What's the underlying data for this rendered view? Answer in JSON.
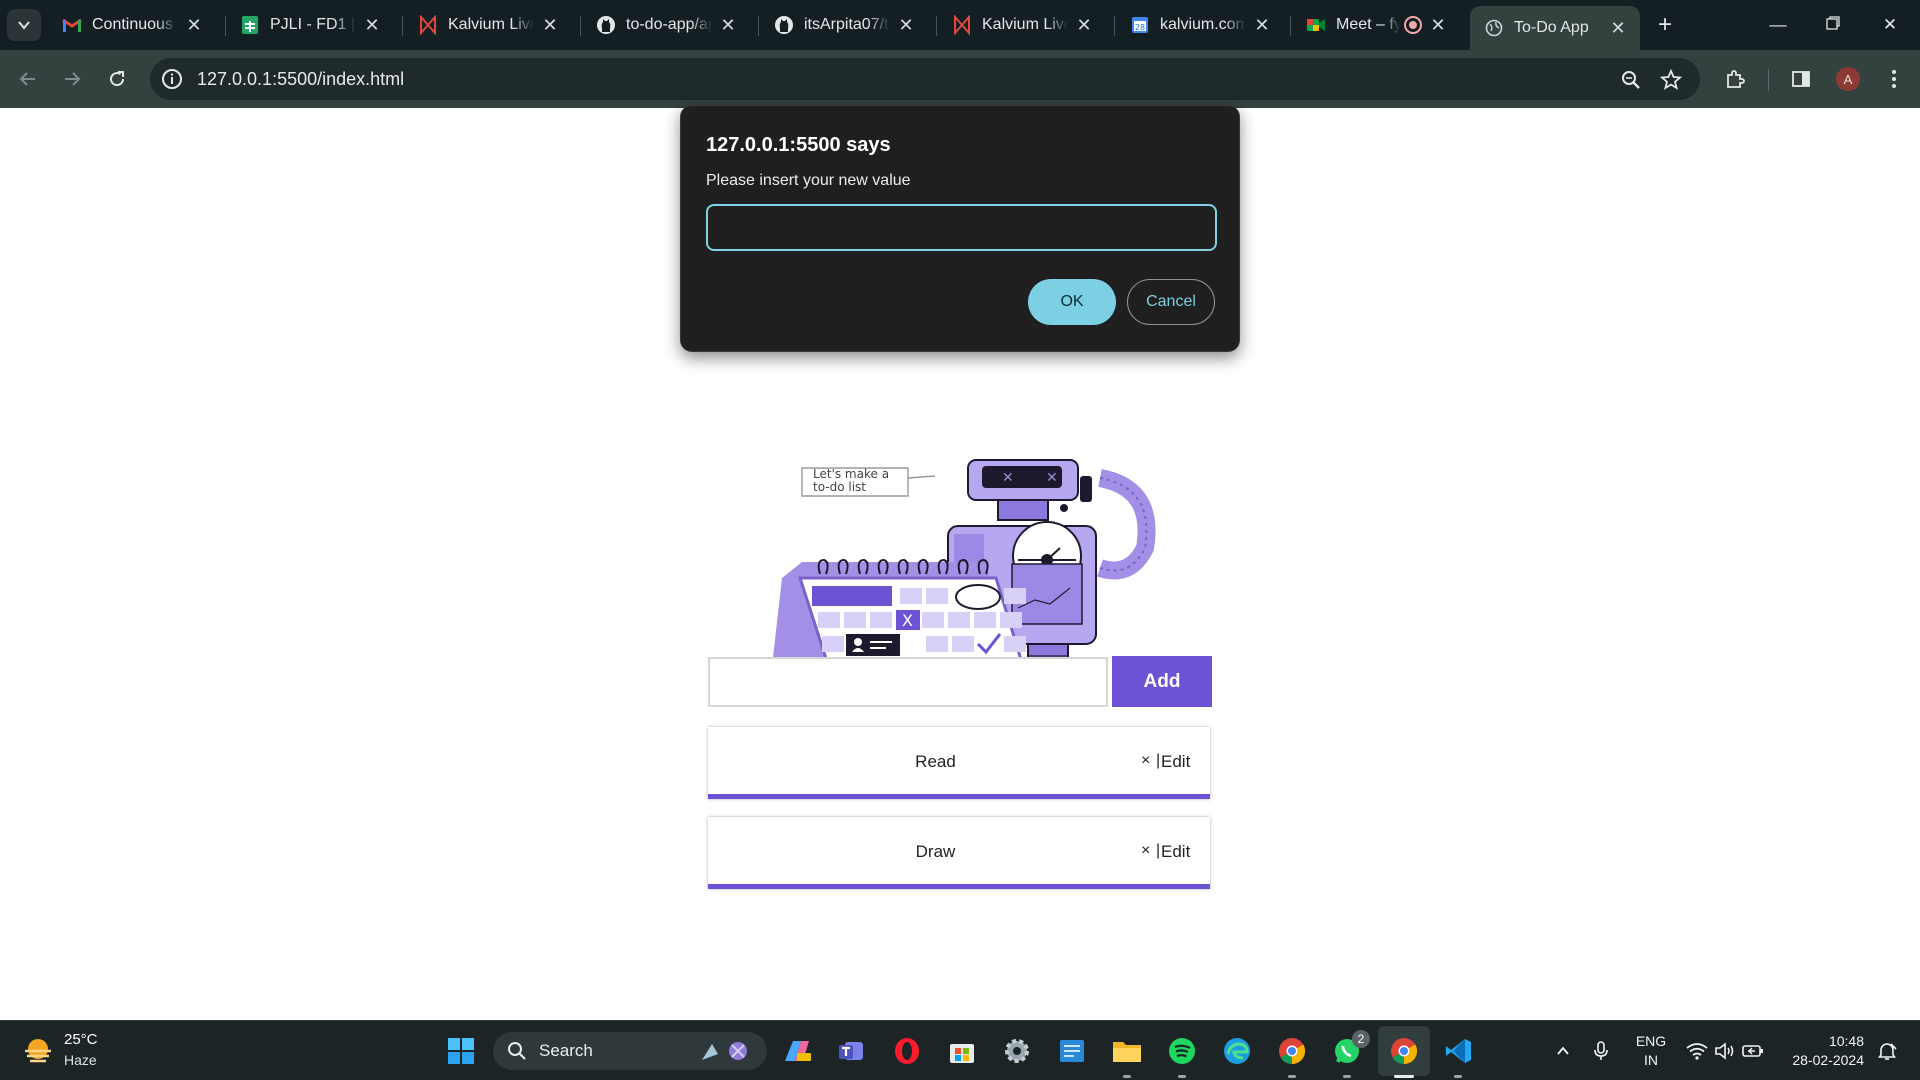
{
  "browser": {
    "tabs": [
      {
        "title": "Continuous A",
        "icon": "gmail-icon",
        "active": false
      },
      {
        "title": "PJLI - FD1 | Sc",
        "icon": "sheets-icon",
        "active": false
      },
      {
        "title": "Kalvium Liveb",
        "icon": "kalvium-icon",
        "active": false
      },
      {
        "title": "to-do-app/ap",
        "icon": "github-icon",
        "active": false
      },
      {
        "title": "itsArpita07/tc",
        "icon": "github-icon",
        "active": false
      },
      {
        "title": "Kalvium Liveb",
        "icon": "kalvium-icon",
        "active": false
      },
      {
        "title": "kalvium.comr",
        "icon": "calendar-icon",
        "active": false
      },
      {
        "title": "Meet – fy",
        "icon": "meet-icon",
        "active": false
      },
      {
        "title": "To-Do App",
        "icon": "globe-icon",
        "active": true
      }
    ],
    "url": "127.0.0.1:5500/index.html",
    "profile_initial": "A"
  },
  "dialog": {
    "title": "127.0.0.1:5500 says",
    "message": "Please insert your new value",
    "input_value": "",
    "ok_label": "OK",
    "cancel_label": "Cancel"
  },
  "illustration": {
    "speech_text_line1": "Let's make a",
    "speech_text_line2": "to-do list"
  },
  "todo": {
    "input_value": "",
    "add_label": "Add",
    "items": [
      {
        "text": "Read",
        "delete_label": "×",
        "separator": "|",
        "edit_label": "Edit"
      },
      {
        "text": "Draw",
        "delete_label": "×",
        "separator": "|",
        "edit_label": "Edit"
      }
    ]
  },
  "taskbar": {
    "weather_temp": "25°C",
    "weather_condition": "Haze",
    "search_label": "Search",
    "whatsapp_badge": "2",
    "language_line1": "ENG",
    "language_line2": "IN",
    "time": "10:48",
    "date": "28-02-2024"
  },
  "colors": {
    "accent_purple": "#6d52d6",
    "dialog_accent": "#7dcfe3",
    "chrome_dark": "#131f22",
    "chrome_toolbar": "#33413f"
  }
}
